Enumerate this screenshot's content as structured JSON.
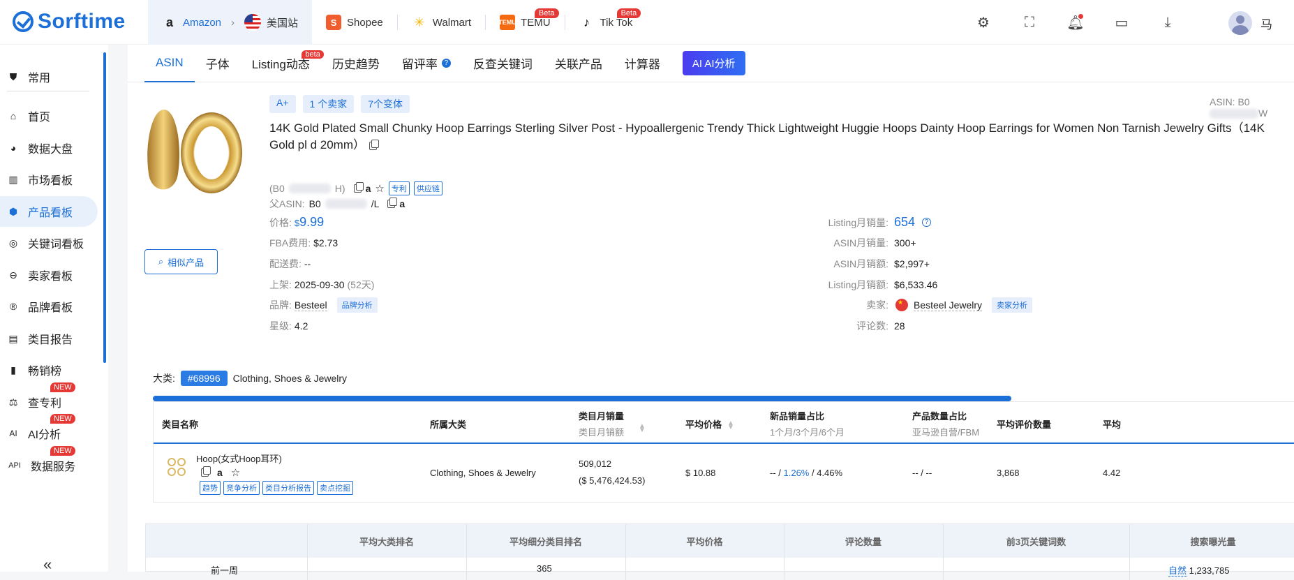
{
  "app": {
    "logo": "Sorftime"
  },
  "platforms": [
    {
      "label": "Amazon",
      "sub": "美国站"
    },
    {
      "label": "Shopee"
    },
    {
      "label": "Walmart"
    },
    {
      "label": "TEMU",
      "badge": "Beta"
    },
    {
      "label": "Tik Tok",
      "badge": "Beta"
    }
  ],
  "user": {
    "name": "马"
  },
  "sidebar": {
    "items": [
      {
        "label": "常用"
      },
      {
        "label": "首页"
      },
      {
        "label": "数据大盘"
      },
      {
        "label": "市场看板"
      },
      {
        "label": "产品看板"
      },
      {
        "label": "关键词看板"
      },
      {
        "label": "卖家看板"
      },
      {
        "label": "品牌看板"
      },
      {
        "label": "类目报告"
      },
      {
        "label": "畅销榜"
      },
      {
        "label": "查专利",
        "badge": "NEW"
      },
      {
        "label": "AI分析",
        "badge": "NEW"
      },
      {
        "label": "数据服务",
        "badge": "NEW",
        "prefix": "API"
      }
    ],
    "collapse": "«"
  },
  "tabs": [
    "ASIN",
    "子体",
    "Listing动态",
    "历史趋势",
    "留评率",
    "反查关键词",
    "关联产品",
    "计算器"
  ],
  "tab_beta": "beta",
  "ai_tab": "AI AI分析",
  "chips": [
    "A+",
    "1 个卖家",
    "7个变体"
  ],
  "asin_label": "ASIN:",
  "asin_partial": "B0",
  "asin_tail": "W",
  "product": {
    "title": "14K Gold Plated Small Chunky Hoop Earrings Sterling Silver Post - Hypoallergenic Trendy Thick Lightweight Huggie Hoops Dainty Hoop Earrings for Women Non Tarnish Jewelry Gifts（14K Gold pl d 20mm）",
    "asin_prefix": "(B0",
    "asin_suffix": "H)",
    "patent": "专利",
    "supply": "供应链",
    "parent_label": "父ASIN:",
    "parent_prefix": "B0",
    "parent_suffix": "/L",
    "similar_btn": "相似产品"
  },
  "left_info": {
    "price_label": "价格:",
    "price_currency": "$",
    "price": "9.99",
    "fba_label": "FBA费用:",
    "fba": "$2.73",
    "ship_label": "配送费:",
    "ship": "--",
    "date_label": "上架:",
    "date": "2025-09-30",
    "date_days": "(52天)",
    "brand_label": "品牌:",
    "brand": "Besteel",
    "brand_tag": "品牌分析",
    "rating_label": "星级:",
    "rating": "4.2"
  },
  "right_info": {
    "listing_sales_label": "Listing月销量:",
    "listing_sales": "654",
    "asin_sales_label": "ASIN月销量:",
    "asin_sales": "300+",
    "asin_rev_label": "ASIN月销额:",
    "asin_rev": "$2,997+",
    "listing_rev_label": "Listing月销额:",
    "listing_rev": "$6,533.46",
    "seller_label": "卖家:",
    "seller": "Besteel Jewelry",
    "seller_tag": "卖家分析",
    "reviews_label": "评论数:",
    "reviews": "28"
  },
  "category": {
    "label": "大类:",
    "rank": "#68996",
    "name": "Clothing, Shoes & Jewelry"
  },
  "table1": {
    "headers": {
      "name": "类目名称",
      "parent": "所属大类",
      "sales": "类目月销量",
      "sales_sub": "类目月销额",
      "price": "平均价格",
      "new_ratio": "新品销量占比",
      "new_ratio_sub": "1个月/3个月/6个月",
      "count_ratio": "产品数量占比",
      "count_ratio_sub": "亚马逊自营/FBM",
      "avg_reviews": "平均评价数量",
      "avg_rating": "平均"
    },
    "row": {
      "name": "Hoop(女式Hoop耳环)",
      "tags": [
        "趋势",
        "竞争分析",
        "类目分析报告",
        "卖点挖掘"
      ],
      "parent": "Clothing, Shoes & Jewelry",
      "sales": "509,012",
      "revenue": "($ 5,476,424.53)",
      "price": "$ 10.88",
      "new_a": "-- / ",
      "new_b": "1.26%",
      "new_c": " / 4.46%",
      "count": "-- / --",
      "avg_reviews": "3,868",
      "avg_rating": "4.42"
    }
  },
  "table2": {
    "headers": [
      "平均大类排名",
      "平均细分类目排名",
      "平均价格",
      "评论数量",
      "前3页关键词数",
      "搜索曝光量"
    ],
    "row": {
      "period": "前一周",
      "sub_rank": "365",
      "exposure_label": "自然",
      "exposure": "1,233,785"
    }
  }
}
